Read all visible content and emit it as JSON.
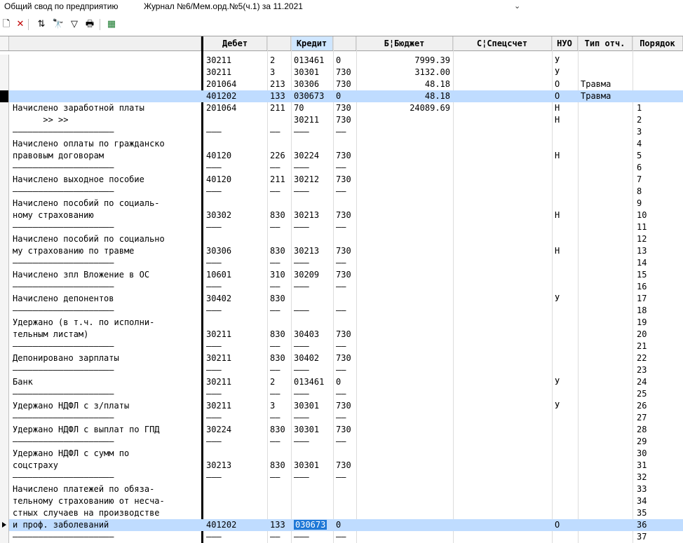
{
  "window": {
    "title_left": "Общий свод по предприятию",
    "title_main": "Журнал №6/Мем.орд.№5(ч.1) за 11.2021",
    "chevron": "⌄"
  },
  "toolbar": {
    "items": [
      {
        "name": "new-doc-icon",
        "glyph": "🗋"
      },
      {
        "name": "delete-icon",
        "glyph": "✕"
      },
      {
        "name": "sort-icon",
        "glyph": "⇅"
      },
      {
        "name": "find-icon",
        "glyph": "🔭"
      },
      {
        "name": "filter-icon",
        "glyph": "▽"
      },
      {
        "name": "print-icon",
        "glyph": "🖶"
      },
      {
        "name": "excel-export-icon",
        "glyph": "▦"
      }
    ]
  },
  "columns": [
    "Дебет",
    "",
    "Кредит",
    "",
    "Б¦Бюджет",
    "С¦Спецсчет",
    "НУО",
    "Тип отч.",
    "Порядок"
  ],
  "rows": [
    {
      "desc": "",
      "d1": "30211",
      "d2": "2",
      "c1": "013461",
      "c2": "0",
      "bud": "7999.39",
      "spec": "",
      "nuo": "У",
      "typ": "",
      "ord": ""
    },
    {
      "desc": "",
      "d1": "30211",
      "d2": "3",
      "c1": "30301",
      "c2": "730",
      "bud": "3132.00",
      "spec": "",
      "nuo": "У",
      "typ": "",
      "ord": ""
    },
    {
      "desc": "",
      "d1": "201064",
      "d2": "213",
      "c1": "30306",
      "c2": "730",
      "bud": "48.18",
      "spec": "",
      "nuo": "О",
      "typ": "Травма",
      "ord": ""
    },
    {
      "desc": "",
      "d1": "401202",
      "d2": "133",
      "c1": "030673",
      "c2": "0",
      "bud": "48.18",
      "spec": "",
      "nuo": "О",
      "typ": "Травма",
      "ord": "",
      "sel": true,
      "cur": true
    },
    {
      "desc": "Начислено заработной платы",
      "d1": "201064",
      "d2": "211",
      "c1": "70",
      "c2": "730",
      "bud": "24089.69",
      "spec": "",
      "nuo": "Н",
      "typ": "",
      "ord": "1"
    },
    {
      "desc": "      >> >>",
      "d1": "",
      "d2": "",
      "c1": "30211",
      "c2": "730",
      "bud": "",
      "spec": "",
      "nuo": "Н",
      "typ": "",
      "ord": "2"
    },
    {
      "desc": "————————————————————",
      "d1": "———",
      "d2": "——",
      "c1": "———",
      "c2": "——",
      "bud": "",
      "spec": "",
      "nuo": "",
      "typ": "",
      "ord": "3"
    },
    {
      "desc": "Начислено оплаты по гражданско",
      "d1": "",
      "d2": "",
      "c1": "",
      "c2": "",
      "bud": "",
      "spec": "",
      "nuo": "",
      "typ": "",
      "ord": "4"
    },
    {
      "desc": "правовым договорам",
      "d1": "40120",
      "d2": "226",
      "c1": "30224",
      "c2": "730",
      "bud": "",
      "spec": "",
      "nuo": "Н",
      "typ": "",
      "ord": "5"
    },
    {
      "desc": "————————————————————",
      "d1": "———",
      "d2": "——",
      "c1": "———",
      "c2": "——",
      "bud": "",
      "spec": "",
      "nuo": "",
      "typ": "",
      "ord": "6"
    },
    {
      "desc": "Начислено выходное пособие",
      "d1": "40120",
      "d2": "211",
      "c1": "30212",
      "c2": "730",
      "bud": "",
      "spec": "",
      "nuo": "",
      "typ": "",
      "ord": "7"
    },
    {
      "desc": "————————————————————",
      "d1": "———",
      "d2": "——",
      "c1": "———",
      "c2": "——",
      "bud": "",
      "spec": "",
      "nuo": "",
      "typ": "",
      "ord": "8"
    },
    {
      "desc": "Начислено пособий по социаль-",
      "d1": "",
      "d2": "",
      "c1": "",
      "c2": "",
      "bud": "",
      "spec": "",
      "nuo": "",
      "typ": "",
      "ord": "9"
    },
    {
      "desc": "ному страхованию",
      "d1": "30302",
      "d2": "830",
      "c1": "30213",
      "c2": "730",
      "bud": "",
      "spec": "",
      "nuo": "Н",
      "typ": "",
      "ord": "10"
    },
    {
      "desc": "————————————————————",
      "d1": "———",
      "d2": "——",
      "c1": "———",
      "c2": "——",
      "bud": "",
      "spec": "",
      "nuo": "",
      "typ": "",
      "ord": "11"
    },
    {
      "desc": "Начислено пособий по социально",
      "d1": "",
      "d2": "",
      "c1": "",
      "c2": "",
      "bud": "",
      "spec": "",
      "nuo": "",
      "typ": "",
      "ord": "12"
    },
    {
      "desc": "му страхованию по травме",
      "d1": "30306",
      "d2": "830",
      "c1": "30213",
      "c2": "730",
      "bud": "",
      "spec": "",
      "nuo": "Н",
      "typ": "",
      "ord": "13"
    },
    {
      "desc": "————————————————————",
      "d1": "———",
      "d2": "——",
      "c1": "———",
      "c2": "——",
      "bud": "",
      "spec": "",
      "nuo": "",
      "typ": "",
      "ord": "14"
    },
    {
      "desc": "Начислено зпл Вложение в ОС",
      "d1": "10601",
      "d2": "310",
      "c1": "30209",
      "c2": "730",
      "bud": "",
      "spec": "",
      "nuo": "",
      "typ": "",
      "ord": "15"
    },
    {
      "desc": "————————————————————",
      "d1": "———",
      "d2": "——",
      "c1": "———",
      "c2": "——",
      "bud": "",
      "spec": "",
      "nuo": "",
      "typ": "",
      "ord": "16"
    },
    {
      "desc": "Начислено депонентов",
      "d1": "30402",
      "d2": "830",
      "c1": "",
      "c2": "",
      "bud": "",
      "spec": "",
      "nuo": "У",
      "typ": "",
      "ord": "17"
    },
    {
      "desc": "————————————————————",
      "d1": "———",
      "d2": "——",
      "c1": "———",
      "c2": "——",
      "bud": "",
      "spec": "",
      "nuo": "",
      "typ": "",
      "ord": "18"
    },
    {
      "desc": "Удержано (в т.ч. по исполни-",
      "d1": "",
      "d2": "",
      "c1": "",
      "c2": "",
      "bud": "",
      "spec": "",
      "nuo": "",
      "typ": "",
      "ord": "19"
    },
    {
      "desc": "тельным листам)",
      "d1": "30211",
      "d2": "830",
      "c1": "30403",
      "c2": "730",
      "bud": "",
      "spec": "",
      "nuo": "",
      "typ": "",
      "ord": "20"
    },
    {
      "desc": "————————————————————",
      "d1": "———",
      "d2": "——",
      "c1": "———",
      "c2": "——",
      "bud": "",
      "spec": "",
      "nuo": "",
      "typ": "",
      "ord": "21"
    },
    {
      "desc": "Депонировано зарплаты",
      "d1": "30211",
      "d2": "830",
      "c1": "30402",
      "c2": "730",
      "bud": "",
      "spec": "",
      "nuo": "",
      "typ": "",
      "ord": "22"
    },
    {
      "desc": "————————————————————",
      "d1": "———",
      "d2": "——",
      "c1": "———",
      "c2": "——",
      "bud": "",
      "spec": "",
      "nuo": "",
      "typ": "",
      "ord": "23"
    },
    {
      "desc": "Банк",
      "d1": "30211",
      "d2": "2",
      "c1": "013461",
      "c2": "0",
      "bud": "",
      "spec": "",
      "nuo": "У",
      "typ": "",
      "ord": "24"
    },
    {
      "desc": "————————————————————",
      "d1": "———",
      "d2": "——",
      "c1": "———",
      "c2": "——",
      "bud": "",
      "spec": "",
      "nuo": "",
      "typ": "",
      "ord": "25"
    },
    {
      "desc": "Удержано НДФЛ с з/платы",
      "d1": "30211",
      "d2": "3",
      "c1": "30301",
      "c2": "730",
      "bud": "",
      "spec": "",
      "nuo": "У",
      "typ": "",
      "ord": "26"
    },
    {
      "desc": "————————————————————",
      "d1": "———",
      "d2": "——",
      "c1": "———",
      "c2": "——",
      "bud": "",
      "spec": "",
      "nuo": "",
      "typ": "",
      "ord": "27"
    },
    {
      "desc": "Удержано НДФЛ с выплат по ГПД",
      "d1": "30224",
      "d2": "830",
      "c1": "30301",
      "c2": "730",
      "bud": "",
      "spec": "",
      "nuo": "",
      "typ": "",
      "ord": "28"
    },
    {
      "desc": "————————————————————",
      "d1": "———",
      "d2": "——",
      "c1": "———",
      "c2": "——",
      "bud": "",
      "spec": "",
      "nuo": "",
      "typ": "",
      "ord": "29"
    },
    {
      "desc": "Удержано НДФЛ с сумм по",
      "d1": "",
      "d2": "",
      "c1": "",
      "c2": "",
      "bud": "",
      "spec": "",
      "nuo": "",
      "typ": "",
      "ord": "30"
    },
    {
      "desc": "соцстраху",
      "d1": "30213",
      "d2": "830",
      "c1": "30301",
      "c2": "730",
      "bud": "",
      "spec": "",
      "nuo": "",
      "typ": "",
      "ord": "31"
    },
    {
      "desc": "————————————————————",
      "d1": "———",
      "d2": "——",
      "c1": "———",
      "c2": "——",
      "bud": "",
      "spec": "",
      "nuo": "",
      "typ": "",
      "ord": "32"
    },
    {
      "desc": "Начислено платежей по обяза-",
      "d1": "",
      "d2": "",
      "c1": "",
      "c2": "",
      "bud": "",
      "spec": "",
      "nuo": "",
      "typ": "",
      "ord": "33"
    },
    {
      "desc": "тельному страхованию от несча-",
      "d1": "",
      "d2": "",
      "c1": "",
      "c2": "",
      "bud": "",
      "spec": "",
      "nuo": "",
      "typ": "",
      "ord": "34"
    },
    {
      "desc": "стных случаев на производстве",
      "d1": "",
      "d2": "",
      "c1": "",
      "c2": "",
      "bud": "",
      "spec": "",
      "nuo": "",
      "typ": "",
      "ord": "35"
    },
    {
      "desc": "и проф. заболеваний",
      "d1": "401202",
      "d2": "133",
      "c1": "030673",
      "c2": "0",
      "bud": "",
      "spec": "",
      "nuo": "О",
      "typ": "",
      "ord": "36",
      "sel": true,
      "ptr": true,
      "c1hl": true
    },
    {
      "desc": "————————————————————",
      "d1": "———",
      "d2": "——",
      "c1": "———",
      "c2": "——",
      "bud": "",
      "spec": "",
      "nuo": "",
      "typ": "",
      "ord": "37"
    }
  ]
}
